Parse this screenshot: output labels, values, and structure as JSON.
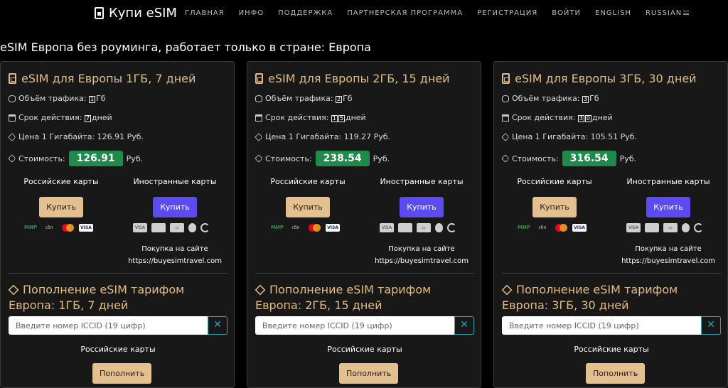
{
  "brand": {
    "name": "Купи eSIM"
  },
  "nav": [
    "ГЛАВНАЯ",
    "ИНФО",
    "ПОДДЕРЖКА",
    "ПАРТНЕРСКАЯ ПРОГРАММА",
    "РЕГИСТРАЦИЯ",
    "ВОЙТИ",
    "ENGLISH",
    "RUSSIAN"
  ],
  "page_title": "eSIM Европа без роуминга, работает только в стране: Европа",
  "labels": {
    "traffic": "Объём трафика:",
    "traffic_unit": "Гб",
    "validity": "Срок действия:",
    "validity_unit": "дней",
    "price_per_gb": "Цена 1 Гигабайта:",
    "cost": "Стоимость:",
    "currency": "Руб.",
    "ru_cards": "Российские карты",
    "foreign_cards": "Иностранные карты",
    "buy_gold": "Купить",
    "buy_purple": "Купить",
    "site_note_1": "Покупка на сайте",
    "site_note_2": "https://buyesimtravel.com",
    "iccid_placeholder": "Введите номер ICCID (19 цифр)",
    "clear": "✕",
    "topup_btn": "Пополнить"
  },
  "cards": [
    {
      "title": "eSIM для Европы 1ГБ, 7 дней",
      "gb_digits": [
        "1"
      ],
      "days_digits": [
        "7"
      ],
      "price_per_gb": "126.91 Руб.",
      "price": "126.91",
      "topup_title": "Пополнение eSIM тарифом Европа: 1ГБ, 7 дней"
    },
    {
      "title": "eSIM для Европы 2ГБ, 15 дней",
      "gb_digits": [
        "2"
      ],
      "days_digits": [
        "1",
        "5"
      ],
      "price_per_gb": "119.27 Руб.",
      "price": "238.54",
      "topup_title": "Пополнение eSIM тарифом Европа: 2ГБ, 15 дней"
    },
    {
      "title": "eSIM для Европы 3ГБ, 30 дней",
      "gb_digits": [
        "3"
      ],
      "days_digits": [
        "3",
        "0"
      ],
      "price_per_gb": "105.51 Руб.",
      "price": "316.54",
      "topup_title": "Пополнение eSIM тарифом Европа: 3ГБ, 30 дней"
    }
  ],
  "logos_ru": [
    "mir-logo",
    "sbp-logo",
    "mastercard-logo",
    "visa-logo"
  ],
  "logos_foreign": [
    "visa-logo",
    "mastercard-logo",
    "card-logo",
    "apple-pay-logo",
    "google-pay-logo"
  ],
  "logo_text": {
    "mir": "МИР",
    "sbp": "сбп",
    "visa": "VISA",
    "visa_gray": "VISA",
    "card_gray": "▭"
  },
  "colors": {
    "accent": "#e2bd84",
    "price_badge": "#1f8a4c",
    "purple_button": "#5b4bf0",
    "gold_button": "#e3c08d"
  }
}
